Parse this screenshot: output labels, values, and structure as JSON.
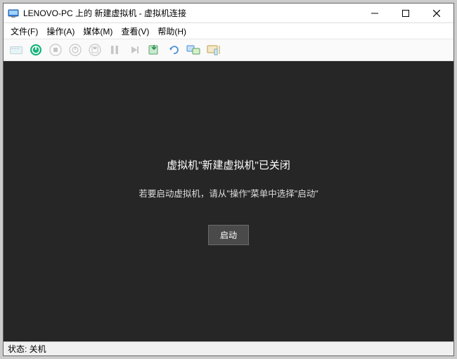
{
  "titlebar": {
    "title": "LENOVO-PC 上的 新建虚拟机 - 虚拟机连接"
  },
  "menu": {
    "file": "文件(F)",
    "action": "操作(A)",
    "media": "媒体(M)",
    "view": "查看(V)",
    "help": "帮助(H)"
  },
  "toolbar": {
    "ctrl_alt_del": "Ctrl+Alt+Del",
    "start": "启动",
    "shutdown": "关闭",
    "save": "保存",
    "pause": "暂停",
    "reset": "重置",
    "checkpoint": "检查点",
    "revert": "还原",
    "enhanced": "增强会话",
    "share": "共享"
  },
  "viewport": {
    "heading": "虚拟机\"新建虚拟机\"已关闭",
    "message": "若要启动虚拟机，请从\"操作\"菜单中选择\"启动\"",
    "start_label": "启动"
  },
  "statusbar": {
    "text": "状态: 关机"
  }
}
